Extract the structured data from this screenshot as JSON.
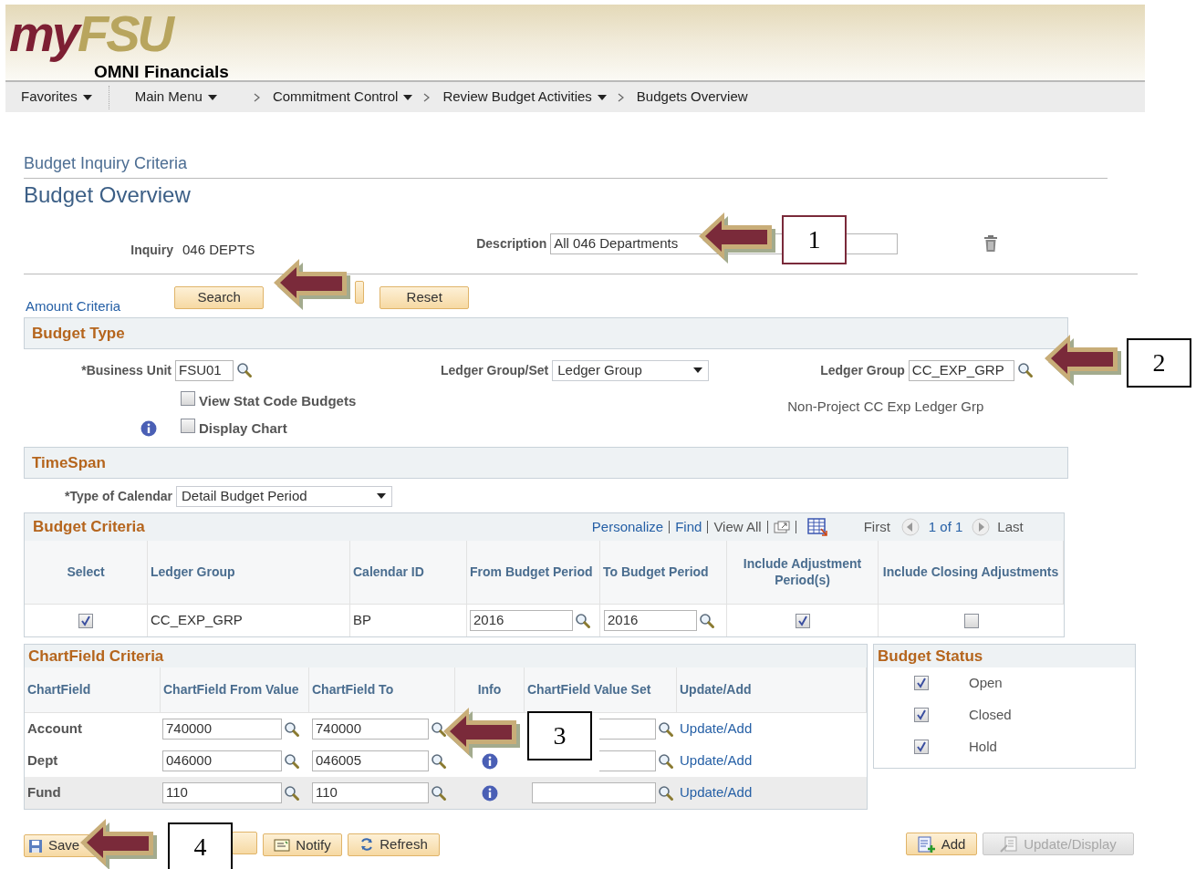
{
  "header": {
    "logo_left": "my",
    "logo_right": "FSU",
    "product": "OMNI Financials"
  },
  "nav": [
    {
      "label": "Favorites",
      "kind": "menu"
    },
    {
      "label": "Main Menu",
      "kind": "menu"
    },
    {
      "label": "Commitment Control",
      "kind": "crumb_menu"
    },
    {
      "label": "Review Budget Activities",
      "kind": "crumb_menu"
    },
    {
      "label": "Budgets Overview",
      "kind": "crumb"
    }
  ],
  "breadcrumb_title": "Budget Inquiry Criteria",
  "page_title": "Budget Overview",
  "inquiry": {
    "label": "Inquiry",
    "value": "046 DEPTS"
  },
  "description": {
    "label": "Description",
    "value": "All 046 Departments"
  },
  "amount_criteria_link": "Amount Criteria",
  "top_buttons": [
    "Search",
    "Reset"
  ],
  "budget_type": {
    "title": "Budget Type",
    "business_unit": {
      "label": "*Business Unit",
      "value": "FSU01"
    },
    "ledger_group_set": {
      "label": "Ledger Group/Set",
      "value": "Ledger Group"
    },
    "ledger_group": {
      "label": "Ledger Group",
      "value": "CC_EXP_GRP",
      "description": "Non-Project CC Exp Ledger Grp"
    },
    "checkboxes": [
      {
        "label": "View Stat Code Budgets",
        "checked": false
      },
      {
        "label": "Display Chart",
        "checked": false
      }
    ]
  },
  "timespan": {
    "title": "TimeSpan",
    "type_of_calendar": {
      "label": "*Type of Calendar",
      "value": "Detail Budget Period"
    }
  },
  "budget_criteria": {
    "title": "Budget Criteria",
    "toolbar": [
      {
        "label": "Personalize",
        "kind": "link"
      },
      {
        "label": "Find",
        "kind": "link"
      },
      {
        "label": "View All",
        "kind": "text"
      }
    ],
    "pager": {
      "first": "First",
      "range": "1 of 1",
      "last": "Last"
    },
    "columns": [
      "Select",
      "Ledger Group",
      "Calendar ID",
      "From Budget Period",
      "To Budget Period",
      "Include Adjustment Period(s)",
      "Include Closing Adjustments"
    ],
    "rows": [
      {
        "select": true,
        "ledger_group": "CC_EXP_GRP",
        "calendar_id": "BP",
        "from": "2016",
        "to": "2016",
        "include_adjustment": true,
        "include_closing": false
      }
    ]
  },
  "chartfield_criteria": {
    "title": "ChartField Criteria",
    "columns": [
      "ChartField",
      "ChartField From Value",
      "ChartField To",
      "Info",
      "ChartField Value Set",
      "Update/Add"
    ],
    "rows": [
      {
        "chartfield": "Account",
        "from": "740000",
        "to": "740000",
        "link": "Update/Add",
        "highlighted": false
      },
      {
        "chartfield": "Dept",
        "from": "046000",
        "to": "046005",
        "link": "Update/Add",
        "highlighted": false
      },
      {
        "chartfield": "Fund",
        "from": "110",
        "to": "110",
        "link": "Update/Add",
        "highlighted": true
      }
    ]
  },
  "budget_status": {
    "title": "Budget Status",
    "items": [
      {
        "label": "Open",
        "checked": true
      },
      {
        "label": "Closed",
        "checked": true
      },
      {
        "label": "Hold",
        "checked": true
      }
    ]
  },
  "bottom_left_buttons": [
    "Save",
    "Notify",
    "Refresh"
  ],
  "bottom_right_buttons": [
    {
      "label": "Add",
      "disabled": false
    },
    {
      "label": "Update/Display",
      "disabled": true
    }
  ],
  "annotations": [
    {
      "kind": "callout",
      "number": "1"
    },
    {
      "kind": "arrow"
    },
    {
      "kind": "callout",
      "number": "2"
    },
    {
      "kind": "callout",
      "number": "3"
    },
    {
      "kind": "callout",
      "number": "4"
    }
  ]
}
